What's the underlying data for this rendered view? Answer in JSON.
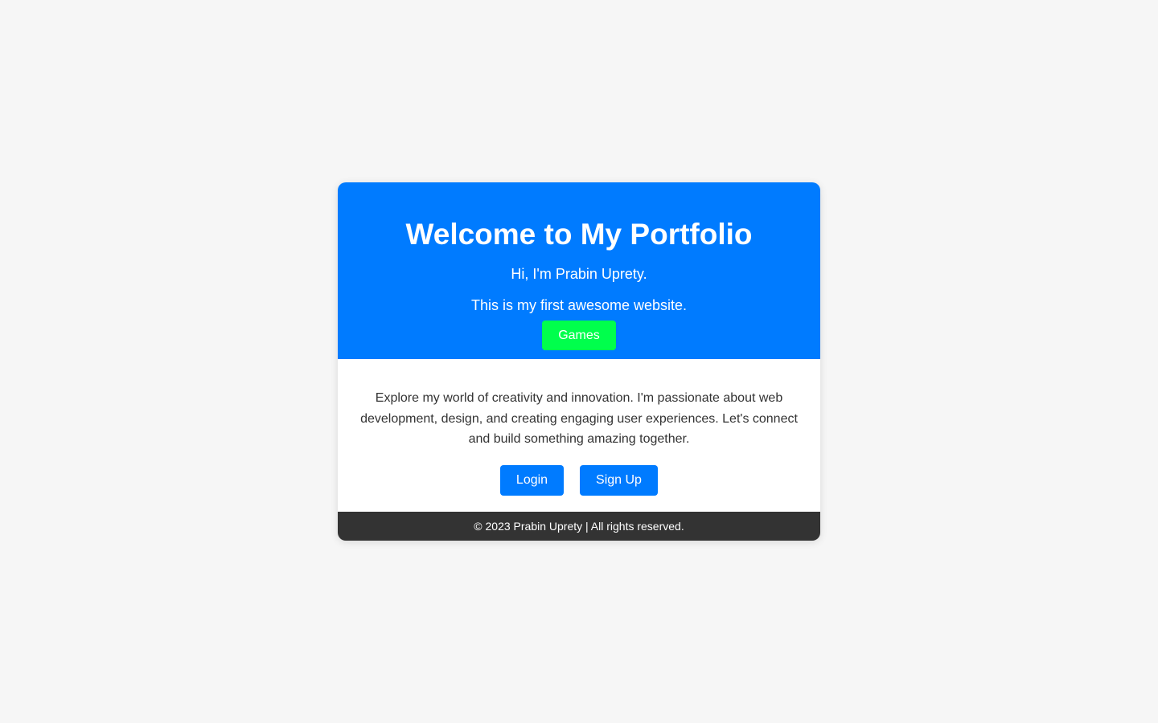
{
  "hero": {
    "title": "Welcome to My Portfolio",
    "greeting": "Hi, I'm Prabin Uprety.",
    "tagline": "This is my first awesome website.",
    "games_label": "Games"
  },
  "content": {
    "intro": "Explore my world of creativity and innovation. I'm passionate about web development, design, and creating engaging user experiences. Let's connect and build something amazing together.",
    "login_label": "Login",
    "signup_label": "Sign Up"
  },
  "footer": {
    "text": "© 2023 Prabin Uprety | All rights reserved."
  },
  "colors": {
    "hero_bg": "#007bff",
    "games_bg": "#00ff4c",
    "button_bg": "#007bff",
    "footer_bg": "#333333",
    "page_bg": "#f6f6f6"
  }
}
